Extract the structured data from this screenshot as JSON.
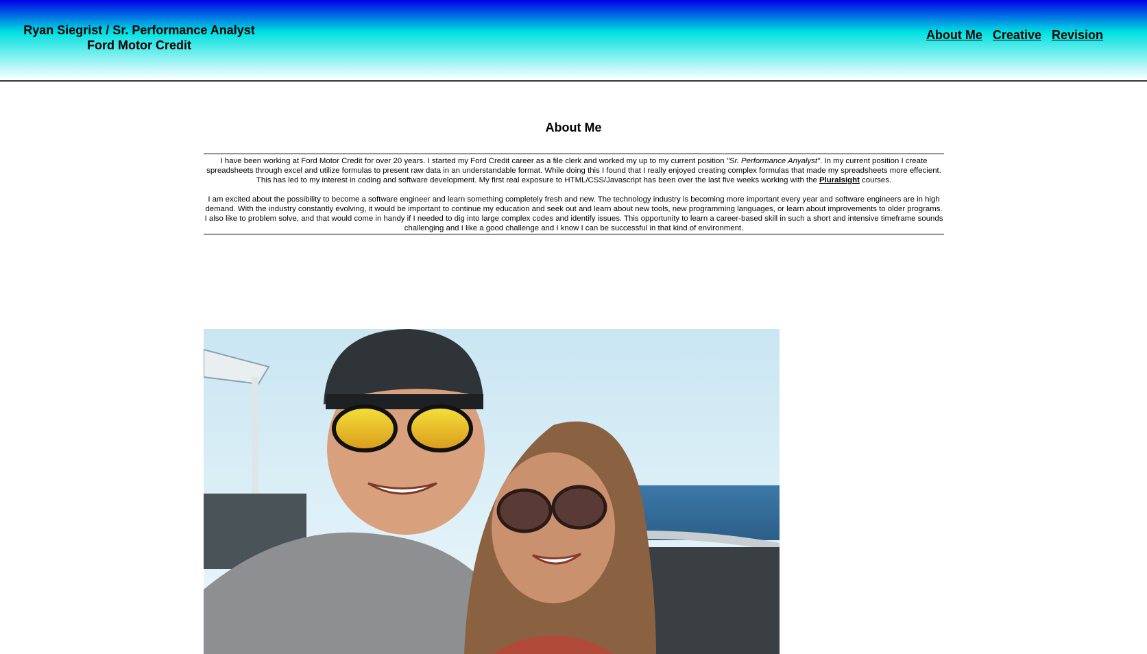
{
  "header": {
    "brand_line1": "Ryan Siegrist / Sr. Performance Analyst",
    "brand_line2": "Ford Motor Credit",
    "nav": [
      {
        "label": "About Me"
      },
      {
        "label": "Creative"
      },
      {
        "label": "Revision"
      }
    ]
  },
  "main": {
    "title": "About Me",
    "para1_a": "I have been working at Ford Motor Credit for over 20 years. I started my Ford Credit career as a file clerk and worked my up to my current position ",
    "para1_em": "\"Sr. Performance Anyalyst\"",
    "para1_b": ". In my current position I create spreadsheets through excel and utilize formulas to present raw data in an understandable format. While doing this I found that I really enjoyed creating complex formulas that made my spreadsheets more effecient. This has led to my interest in coding and software development. My first real exposure to HTML/CSS/Javascript has been over the last five weeks working with the ",
    "para1_link": "Pluralsight",
    "para1_c": " courses.",
    "para2": "I am excited about the possibility to become a software engineer and learn something completely fresh and new. The technology industry is becoming more important every year and software engineers are in high demand. With the industry constantly evolving, it would be important to continue my education and seek out and learn about new tools, new programming languages, or learn about improvements to older programs. I also like to problem solve, and that would come in handy if I needed to dig into large complex codes and identify issues. This opportunity to learn a career-based skill in such a short and intensive timeframe sounds challenging and I like a good challenge and I know I can be successful in that kind of environment."
  },
  "colors": {
    "header_top": "#0000e6",
    "header_mid": "#00e0e0",
    "header_bottom": "#ffffff"
  }
}
